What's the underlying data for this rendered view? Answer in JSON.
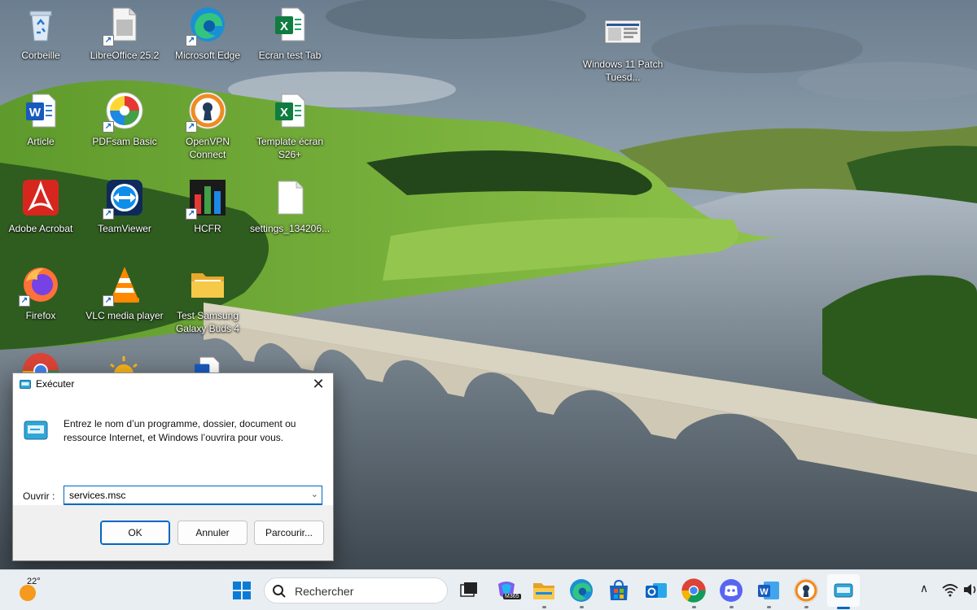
{
  "desktop": {
    "icons": [
      {
        "label": "Corbeille",
        "icon": "recycle-bin-icon"
      },
      {
        "label": "LibreOffice 25.2",
        "icon": "libreoffice-icon"
      },
      {
        "label": "Microsoft Edge",
        "icon": "edge-icon"
      },
      {
        "label": "Ecran test Tab",
        "icon": "excel-file-icon"
      },
      {
        "label": "Windows 11 Patch Tuesd...",
        "icon": "screenshot-file-icon"
      },
      {
        "label": "Article",
        "icon": "word-file-icon"
      },
      {
        "label": "PDFsam Basic",
        "icon": "pdfsam-icon"
      },
      {
        "label": "OpenVPN Connect",
        "icon": "openvpn-icon"
      },
      {
        "label": "Template écran S26+",
        "icon": "excel-file-icon"
      },
      {
        "label": "Adobe Acrobat",
        "icon": "acrobat-icon"
      },
      {
        "label": "TeamViewer",
        "icon": "teamviewer-icon"
      },
      {
        "label": "HCFR",
        "icon": "hcfr-icon"
      },
      {
        "label": "settings_134206...",
        "icon": "blank-file-icon"
      },
      {
        "label": "Firefox",
        "icon": "firefox-icon"
      },
      {
        "label": "VLC media player",
        "icon": "vlc-icon"
      },
      {
        "label": "Test Samsung Galaxy Buds 4",
        "icon": "folder-icon"
      }
    ]
  },
  "run_dialog": {
    "title": "Exécuter",
    "close_label": "✕",
    "description": "Entrez le nom d’un programme, dossier, document ou ressource Internet, et Windows l’ouvrira pour vous.",
    "open_label": "Ouvrir :",
    "open_value": "services.msc",
    "ok_label": "OK",
    "cancel_label": "Annuler",
    "browse_label": "Parcourir..."
  },
  "taskbar": {
    "weather_temp": "22°",
    "search_placeholder": "Rechercher",
    "apps": [
      "start-icon",
      "task-view-icon",
      "m365-copilot-icon",
      "file-explorer-icon",
      "edge-icon",
      "store-icon",
      "outlook-icon",
      "chrome-icon",
      "discord-icon",
      "word-icon",
      "openvpn-icon",
      "run-app-icon"
    ],
    "m365_badge": "M365",
    "tray_caret": "∧"
  },
  "colors": {
    "accent": "#0067c0",
    "taskbar_bg": "#e9eef3",
    "dialog_bg": "#f3f3f3"
  }
}
